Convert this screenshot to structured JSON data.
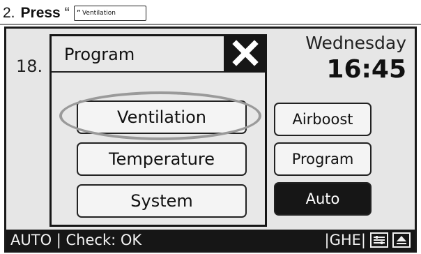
{
  "instruction": {
    "step_number": "2.",
    "press": "Press",
    "open_quote": "“",
    "button_preview": {
      "quote": "”",
      "label": "Ventilation"
    }
  },
  "screen": {
    "temperature": "18.",
    "day": "Wednesday",
    "time": "16:45",
    "side_buttons": [
      {
        "label": "Airboost"
      },
      {
        "label": "Program"
      },
      {
        "label": "Auto"
      }
    ],
    "status_bar": {
      "left": "AUTO | Check: OK",
      "right": "|GHE|"
    }
  },
  "dialog": {
    "title": "Program",
    "close_icon": "close-x-icon",
    "items": [
      {
        "label": "Ventilation"
      },
      {
        "label": "Temperature"
      },
      {
        "label": "System"
      }
    ]
  },
  "colors": {
    "screen_bg": "#e6e6e6",
    "dark": "#161616",
    "highlight": "#9a9a9a"
  }
}
